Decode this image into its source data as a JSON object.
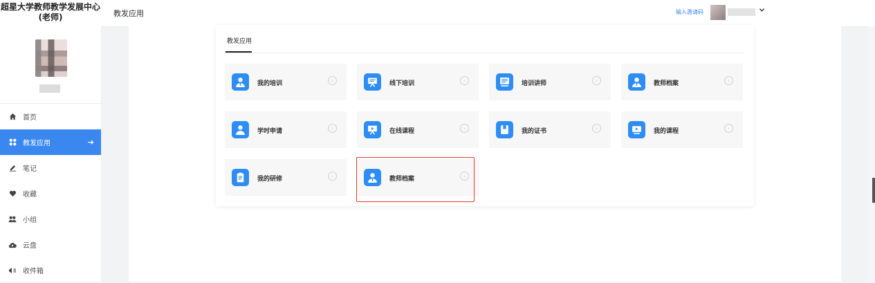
{
  "sidebar": {
    "org_name": "超星大学教师教学发展中心",
    "role": "(老师)",
    "items": [
      {
        "label": "首页",
        "icon": "home-icon"
      },
      {
        "label": "教发应用",
        "icon": "apps-icon",
        "active": true
      },
      {
        "label": "笔记",
        "icon": "pen-icon"
      },
      {
        "label": "收藏",
        "icon": "heart-icon"
      },
      {
        "label": "小组",
        "icon": "group-icon"
      },
      {
        "label": "云盘",
        "icon": "cloud-icon"
      },
      {
        "label": "收件箱",
        "icon": "inbox-icon"
      }
    ]
  },
  "header": {
    "breadcrumb": "教发应用",
    "invite_text": "输入邀请码"
  },
  "main": {
    "tab": "教发应用",
    "tiles": [
      {
        "label": "我的培训",
        "icon": "teacher-icon"
      },
      {
        "label": "线下培训",
        "icon": "board-icon"
      },
      {
        "label": "培训讲师",
        "icon": "lecturer-icon"
      },
      {
        "label": "教师档案",
        "icon": "teacher-icon"
      },
      {
        "label": "学时申请",
        "icon": "teacher-icon"
      },
      {
        "label": "在线课程",
        "icon": "board-icon"
      },
      {
        "label": "我的证书",
        "icon": "certificate-icon"
      },
      {
        "label": "我的课程",
        "icon": "video-icon"
      },
      {
        "label": "我的研修",
        "icon": "clipboard-icon"
      },
      {
        "label": "教师档案",
        "icon": "teacher-icon"
      }
    ]
  },
  "colors": {
    "accent": "#3a87f0",
    "icon_bg": "#2e8df5",
    "highlight": "#e53935"
  }
}
